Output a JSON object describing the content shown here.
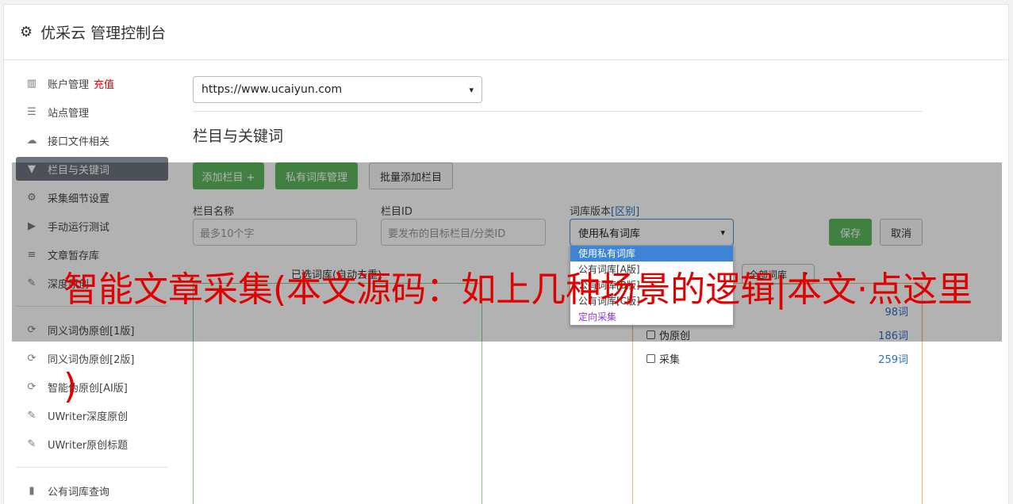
{
  "header": {
    "title": "优采云 管理控制台",
    "icon": "gear-icon"
  },
  "sidebar": {
    "items": [
      {
        "label": "账户管理",
        "icon": "bar-chart-icon",
        "extra": "充值"
      },
      {
        "label": "站点管理",
        "icon": "server-icon"
      },
      {
        "label": "接口文件相关",
        "icon": "cloud-upload-icon"
      },
      {
        "label": "栏目与关键词",
        "icon": "filter-icon",
        "active": true
      },
      {
        "label": "采集细节设置",
        "icon": "cogs-icon"
      },
      {
        "label": "手动运行测试",
        "icon": "play-circle-icon"
      },
      {
        "label": "文章暂存库",
        "icon": "database-icon"
      },
      {
        "label": "深度原创",
        "icon": "edit-icon"
      }
    ],
    "items2": [
      {
        "label": "同义词伪原创[1版]",
        "icon": "refresh-icon"
      },
      {
        "label": "同义词伪原创[2版]",
        "icon": "refresh-icon"
      },
      {
        "label": "智能伪原创[AI版]",
        "icon": "refresh-icon"
      },
      {
        "label": "UWriter深度原创",
        "icon": "edit-icon"
      },
      {
        "label": "UWriter原创标题",
        "icon": "edit-icon"
      }
    ],
    "items3": [
      {
        "label": "公有词库查询",
        "icon": "book-icon"
      }
    ]
  },
  "site": {
    "selected": "https://www.ucaiyun.com"
  },
  "section": {
    "title": "栏目与关键词"
  },
  "toolbar": {
    "add_column": "添加栏目 +",
    "private_lib": "私有词库管理",
    "batch_add": "批量添加栏目"
  },
  "form": {
    "name_label": "栏目名称",
    "name_placeholder": "最多10个字",
    "id_label": "栏目ID",
    "id_placeholder": "要发布的目标栏目/分类ID",
    "version_label": "词库版本",
    "version_link": "[区别]",
    "version_selected": "使用私有词库",
    "save": "保存",
    "cancel": "取消"
  },
  "dropdown": {
    "options": [
      "使用私有词库",
      "公有词库[A版]",
      "公有词库[B版]",
      "公有词库[C版]",
      "定向采集"
    ]
  },
  "lists": {
    "left_label": "已选词库(自动去重)",
    "filter_selected": "全部词库",
    "libraries": [
      {
        "name": "",
        "count": "98词"
      },
      {
        "name": "伪原创",
        "count": "186词"
      },
      {
        "name": "采集",
        "count": "259词"
      }
    ]
  },
  "banner": {
    "text": "智能文章采集(本文源码：如上几种场景的逻辑|本文·点这里",
    "text2": ")"
  }
}
